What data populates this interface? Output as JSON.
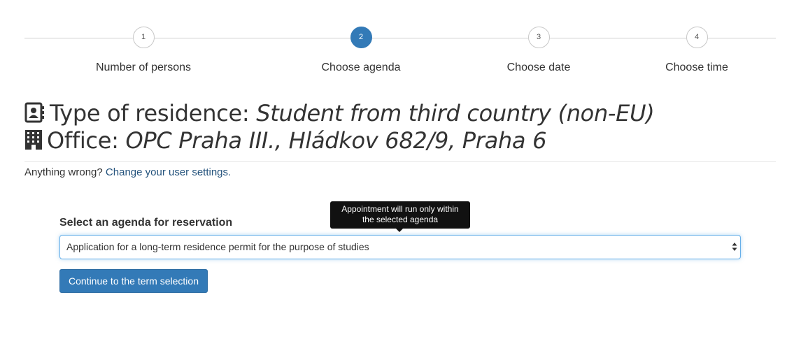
{
  "stepper": {
    "steps": [
      {
        "number": "1",
        "label": "Number of persons"
      },
      {
        "number": "2",
        "label": "Choose agenda"
      },
      {
        "number": "3",
        "label": "Choose date"
      },
      {
        "number": "4",
        "label": "Choose time"
      }
    ],
    "active_step": 2,
    "accent_color": "#337ab7"
  },
  "summary": {
    "residence_prefix": "Type of residence:",
    "residence_value": "Student from third country (non-EU)",
    "residence_icon": "contact-card-icon",
    "office_prefix": "Office:",
    "office_value": "OPC Praha III., Hládkov 682/9, Praha 6",
    "office_icon": "building-icon"
  },
  "notice": {
    "text": "Anything wrong?",
    "link_text": "Change your user settings."
  },
  "form": {
    "label": "Select an agenda for reservation",
    "tooltip": "Appointment will run only within the selected agenda",
    "selected_agenda": "Application for a long-term residence permit for the purpose of studies",
    "continue_button": "Continue to the term selection"
  }
}
